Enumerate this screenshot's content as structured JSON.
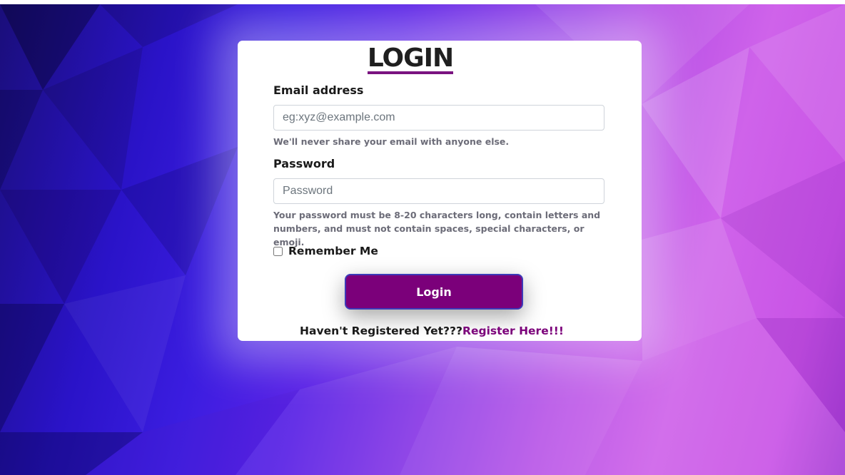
{
  "login": {
    "title": "LOGIN",
    "email_label": "Email address",
    "email_placeholder": "eg:xyz@example.com",
    "email_help": "We'll never share your email with anyone else.",
    "password_label": "Password",
    "password_placeholder": "Password",
    "password_help": "Your password must be 8-20 characters long, contain letters and numbers, and must not contain spaces, special characters, or emoji.",
    "remember_label": "Remember Me",
    "remember_checked": false,
    "button_label": "Login",
    "register_prompt": "Haven't Registered Yet???",
    "register_link": "Register Here!!!"
  },
  "colors": {
    "accent": "#7b007a",
    "button_border": "#3c3ab8",
    "background_left": "#2a13c8",
    "background_right": "#cf63ea"
  }
}
